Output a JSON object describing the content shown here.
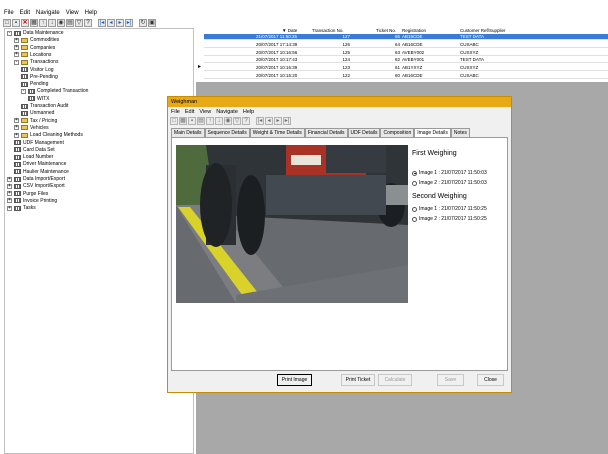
{
  "menu": [
    "File",
    "Edit",
    "Navigate",
    "View",
    "Help"
  ],
  "tree": [
    {
      "label": "Data Maintenance",
      "indent": 0,
      "exp": "-",
      "icon": "grid"
    },
    {
      "label": "Commodities",
      "indent": 1,
      "exp": "+",
      "icon": "folder"
    },
    {
      "label": "Companies",
      "indent": 1,
      "exp": "+",
      "icon": "folder"
    },
    {
      "label": "Locations",
      "indent": 1,
      "exp": "+",
      "icon": "folder"
    },
    {
      "label": "Transactions",
      "indent": 1,
      "exp": "-",
      "icon": "folder"
    },
    {
      "label": "Visitor Log",
      "indent": 2,
      "exp": "",
      "icon": "grid"
    },
    {
      "label": "Pre-Pending",
      "indent": 2,
      "exp": "",
      "icon": "grid"
    },
    {
      "label": "Pending",
      "indent": 2,
      "exp": "",
      "icon": "grid"
    },
    {
      "label": "Completed Transaction",
      "indent": 2,
      "exp": "-",
      "icon": "grid"
    },
    {
      "label": "WITX",
      "indent": 3,
      "exp": "",
      "icon": "grid"
    },
    {
      "label": "Transaction Audit",
      "indent": 2,
      "exp": "",
      "icon": "grid"
    },
    {
      "label": "Unmanned",
      "indent": 2,
      "exp": "",
      "icon": "grid"
    },
    {
      "label": "Tax / Pricing",
      "indent": 1,
      "exp": "+",
      "icon": "folder"
    },
    {
      "label": "Vehicles",
      "indent": 1,
      "exp": "+",
      "icon": "folder"
    },
    {
      "label": "Load Cleaning Methods",
      "indent": 1,
      "exp": "+",
      "icon": "folder"
    },
    {
      "label": "UDF Management",
      "indent": 1,
      "exp": "",
      "icon": "grid"
    },
    {
      "label": "Card Data Set",
      "indent": 1,
      "exp": "",
      "icon": "grid"
    },
    {
      "label": "Load Number",
      "indent": 1,
      "exp": "",
      "icon": "grid"
    },
    {
      "label": "Driver Maintenance",
      "indent": 1,
      "exp": "",
      "icon": "grid"
    },
    {
      "label": "Haulier Maintenance",
      "indent": 1,
      "exp": "",
      "icon": "grid"
    },
    {
      "label": "Data Import/Export",
      "indent": 0,
      "exp": "+",
      "icon": "grid"
    },
    {
      "label": "CSV Import/Export",
      "indent": 0,
      "exp": "+",
      "icon": "grid"
    },
    {
      "label": "Purge Files",
      "indent": 0,
      "exp": "+",
      "icon": "grid"
    },
    {
      "label": "Invoice Printing",
      "indent": 0,
      "exp": "+",
      "icon": "grid"
    },
    {
      "label": "Tasks",
      "indent": 0,
      "exp": "+",
      "icon": "grid"
    }
  ],
  "grid": {
    "headers": [
      "Date",
      "Transaction No.",
      "Ticket No.",
      "Registration",
      "Customer Ref/Supplier"
    ],
    "rows": [
      [
        "21/07/2017 11:50:25",
        "127",
        "65",
        "AB16CDE",
        "TEST DATA"
      ],
      [
        "20/07/2017 17:14:39",
        "126",
        "64",
        "AB16CDE",
        "CUSABC"
      ],
      [
        "20/07/2017 10:16:56",
        "125",
        "63",
        "AVEBY002",
        "CUSXYZ"
      ],
      [
        "20/07/2017 10:17:43",
        "124",
        "62",
        "AVEBY001",
        "TEST DATA"
      ],
      [
        "20/07/2017 10:16:39",
        "123",
        "61",
        "AB1YXYZ",
        "CUSXYZ"
      ],
      [
        "20/07/2017 10:15:20",
        "122",
        "60",
        "AB16CDE",
        "CUSABC"
      ]
    ]
  },
  "dialog": {
    "title": "Weighman",
    "menu": [
      "File",
      "Edit",
      "View",
      "Navigate",
      "Help"
    ],
    "tabs": [
      "Main Details",
      "Sequence Details",
      "Weight & Time Details",
      "Financial Details",
      "UDF Details",
      "Composition",
      "Image Details",
      "Notes"
    ],
    "active_tab": "Image Details",
    "first_weighing": "First Weighing",
    "first_images": [
      "Image 1 : 21/07/2017 11:50:03",
      "Image 2 : 21/07/2017 11:50:03"
    ],
    "second_weighing": "Second Weighing",
    "second_images": [
      "Image 1 : 21/07/2017 11:50:25",
      "Image 2 : 21/07/2017 11:50:25"
    ],
    "buttons": {
      "print_image": "Print Image",
      "print_ticket": "Print Ticket",
      "calculate": "Calculate",
      "save": "Save",
      "close": "Close"
    }
  }
}
